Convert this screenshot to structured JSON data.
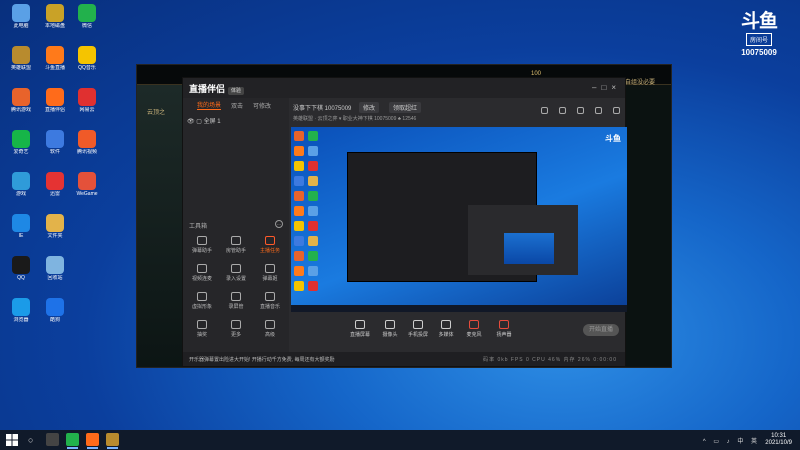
{
  "desktop": {
    "icons": [
      {
        "label": "此电脑",
        "color": "#5aa0e6"
      },
      {
        "label": "本地磁盘",
        "color": "#c9a227"
      },
      {
        "label": "微信",
        "color": "#22b14c"
      },
      {
        "label": "英雄联盟",
        "color": "#b88b2e"
      },
      {
        "label": "斗鱼直播",
        "color": "#ff7a1a"
      },
      {
        "label": "QQ音乐",
        "color": "#f5c400"
      },
      {
        "label": "腾讯游戏",
        "color": "#e8632b"
      },
      {
        "label": "直播伴侣",
        "color": "#ff6b1a"
      },
      {
        "label": "网易云",
        "color": "#e03030"
      },
      {
        "label": "爱奇艺",
        "color": "#16b548"
      },
      {
        "label": "软件",
        "color": "#3d7ae0"
      },
      {
        "label": "腾讯视频",
        "color": "#f05a28"
      },
      {
        "label": "游戏",
        "color": "#2f9bd9"
      },
      {
        "label": "迅雷",
        "color": "#e53333"
      },
      {
        "label": "WeGame",
        "color": "#e4513a"
      },
      {
        "label": "IE",
        "color": "#1e88e5"
      },
      {
        "label": "文件夹",
        "color": "#e3b34a"
      },
      {
        "label": "网盘",
        "color": "#2c7ee8"
      },
      {
        "label": "QQ",
        "color": "#1a1a1a"
      },
      {
        "label": "回收站",
        "color": "#7fb4e0"
      },
      {
        "label": "爱奇艺",
        "color": "#27c23d"
      },
      {
        "label": "浏览器",
        "color": "#1b9be8"
      },
      {
        "label": "酷狗",
        "color": "#1e72e8"
      },
      {
        "label": "QQ",
        "color": "#222"
      }
    ]
  },
  "douyu_badge": {
    "logo": "斗鱼",
    "sub": "房间号",
    "room": "10075009"
  },
  "app": {
    "brand": "直播伴侣",
    "brand_tag": "体验",
    "tabs": [
      "我的场景",
      "双击",
      "可修改"
    ],
    "scene_item": "全屏 1",
    "tools_title": "工具箱",
    "tools": [
      {
        "label": "弹幕助手"
      },
      {
        "label": "房管助手"
      },
      {
        "label": "主播任务"
      },
      {
        "label": "视频连麦"
      },
      {
        "label": "录入设置"
      },
      {
        "label": "弹幕姬"
      },
      {
        "label": "虚拟形象"
      },
      {
        "label": "录屏管"
      },
      {
        "label": "直播音乐"
      },
      {
        "label": "抽奖"
      },
      {
        "label": "更多"
      },
      {
        "label": "高级"
      }
    ],
    "room_title": "没事下下棋 10075009",
    "edit_btn": "修改",
    "topic_btn": "领取超红",
    "meta": "英雄联盟 · 云顶之弈  ▾  职业大神下棋  10075009  ♣ 12546",
    "controls": [
      {
        "label": "直播屏幕"
      },
      {
        "label": "摄像头"
      },
      {
        "label": "手机投屏"
      },
      {
        "label": "多媒体"
      },
      {
        "label": "麦克风"
      },
      {
        "label": "扬声器"
      }
    ],
    "start_btn": "开始直播",
    "notice": "开乐器弹幕置出险进大开始! 开播行动千方免费, 每周还有大额奖励",
    "stats": "码率 0kb   FPS 0   CPU 46%   内存 26%   0:00:00"
  },
  "game": {
    "left_text": "云顶之",
    "right_text": "自组没必要",
    "gold": "100"
  },
  "taskbar": {
    "search_icon": "○",
    "tray": "^ ▭ ♪ 中 英",
    "time": "10:31",
    "date": "2021/10/9"
  }
}
